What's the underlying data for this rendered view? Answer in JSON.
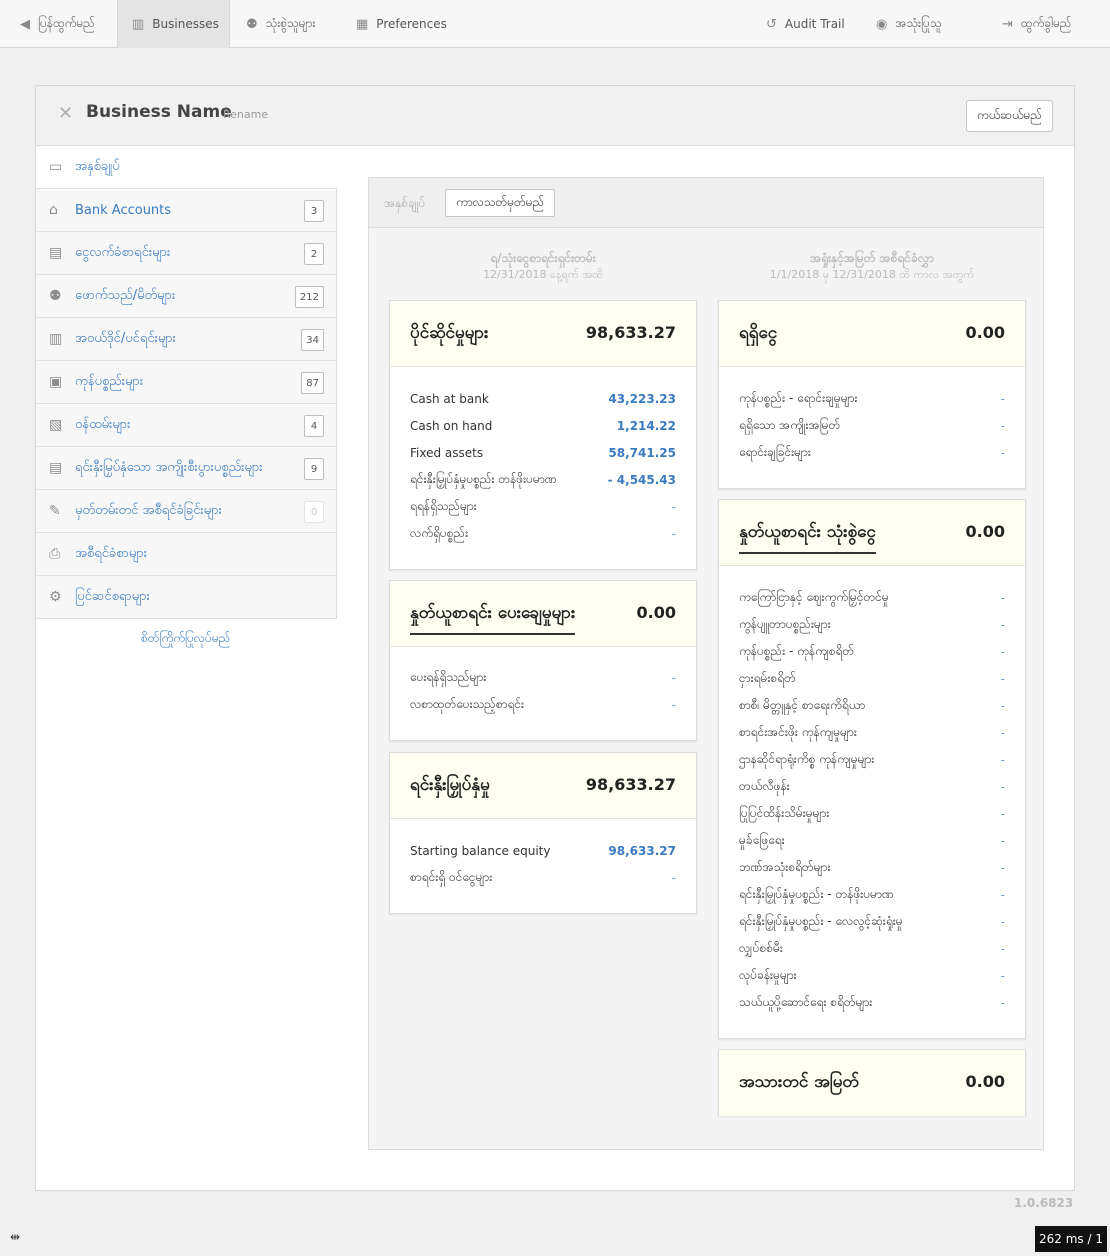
{
  "nav": {
    "back_label": "ပြန်ထွက်မည်",
    "businesses_label": "Businesses",
    "users_label": "သုံးစွဲသူများ",
    "preferences_label": "Preferences",
    "audit_label": "Audit Trail",
    "account_label": "အသုံးပြုသူ",
    "logout_label": "ထွက်ခွါမည်"
  },
  "header": {
    "business_name": "Business Name",
    "rename_label": "Rename",
    "close_label": "ကယ်ဆယ်မည်"
  },
  "sidebar": {
    "items": [
      {
        "label": "အနှစ်ချုပ်",
        "icon": "presentation-icon"
      },
      {
        "label": "Bank Accounts",
        "count": "3",
        "icon": "bank-icon"
      },
      {
        "label": "ငွေလက်ခံစာရင်းများ",
        "count": "2",
        "icon": "cash-register-icon"
      },
      {
        "label": "ဖောက်သည်/မိတ်များ",
        "count": "212",
        "icon": "people-icon"
      },
      {
        "label": "အဝယ်ဒိုင်/ပင်ရင်းများ",
        "count": "34",
        "icon": "building-icon"
      },
      {
        "label": "ကုန်ပစ္စည်းများ",
        "count": "87",
        "icon": "box-icon"
      },
      {
        "label": "ဝန်ထမ်းများ",
        "count": "4",
        "icon": "id-card-icon"
      },
      {
        "label": "ရင်းနှီးမြှပ်နှံသော အကျိုးစီးပွားပစ္စည်းများ",
        "count": "9",
        "icon": "ledger-icon"
      },
      {
        "label": "မှတ်တမ်းတင် အစီရင်ခံခြင်းများ",
        "count": "0",
        "icon": "quill-icon"
      },
      {
        "label": "အစီရင်ခံစာများ",
        "icon": "printer-icon"
      },
      {
        "label": "ပြင်ဆင်စရာများ",
        "icon": "gears-icon"
      }
    ],
    "customize_label": "စိတ်ကြိုက်ပြုလုပ်မည်"
  },
  "summary": {
    "title": "အနှစ်ချုပ်",
    "period_button": "ကာလသတ်မှတ်မည်",
    "left_col_title": "ရ/သုံးငွေစာရင်းရှင်းတမ်း",
    "left_col_sub": "12/31/2018 နေ့ရက် အထိ",
    "right_col_title": "အရှုံးနှင့်အမြတ် အစီရင်ခံလွှာ",
    "right_col_sub": "1/1/2018 မှ 12/31/2018 ထိ ကာလ အတွက်"
  },
  "cards": {
    "assets": {
      "title": "ပိုင်ဆိုင်မှုများ",
      "total": "98,633.27",
      "rows": [
        {
          "label": "Cash at bank",
          "value": "43,223.23"
        },
        {
          "label": "Cash on hand",
          "value": "1,214.22"
        },
        {
          "label": "Fixed assets",
          "value": "58,741.25"
        },
        {
          "label": "ရင်းနှီးမြှုပ်နှံမှုပစ္စည်း တန်ဖိုးပမာဏ",
          "value": "- 4,545.43"
        },
        {
          "label": "ရရန်ရှိသည်များ",
          "value": "-"
        },
        {
          "label": "လက်ရှိပစ္စည်း",
          "value": "-"
        }
      ]
    },
    "liabilities": {
      "title": "နှုတ်ယူစာရင်း ပေးချေမှုများ",
      "total": "0.00",
      "rows": [
        {
          "label": "ပေးရန်ရှိသည်များ",
          "value": "-"
        },
        {
          "label": "လစာထုတ်ပေးသည့်စာရင်း",
          "value": "-"
        }
      ]
    },
    "equity": {
      "title": "ရင်းနှီးမြှုပ်နှံမှု",
      "total": "98,633.27",
      "rows": [
        {
          "label": "Starting balance equity",
          "value": "98,633.27"
        },
        {
          "label": "စာရင်းရှိ ဝင်ငွေများ",
          "value": "-"
        }
      ]
    },
    "income": {
      "title": "ရရှိငွေ",
      "total": "0.00",
      "rows": [
        {
          "label": "ကုန်ပစ္စည်း - ရောင်းချမှုများ",
          "value": "-"
        },
        {
          "label": "ရရှိသော အကျိုးအမြတ်",
          "value": "-"
        },
        {
          "label": "ရောင်းချခြင်းများ",
          "value": "-"
        }
      ]
    },
    "expenses": {
      "title": "နှုတ်ယူစာရင်း သုံးစွဲငွေ",
      "total": "0.00",
      "rows": [
        {
          "label": "ကကြော်ငြာနှင့် ဈေးကွက်မြှင့်တင်မှု",
          "value": "-"
        },
        {
          "label": "ကွန်ပျူတာပစ္စည်းများ",
          "value": "-"
        },
        {
          "label": "ကုန်ပစ္စည်း - ကုန်ကျစရိတ်",
          "value": "-"
        },
        {
          "label": "ငှားရမ်းစရိတ်",
          "value": "-"
        },
        {
          "label": "စာစီ၊ မိတ္တူနှင့် စာရေးကိရိယာ",
          "value": "-"
        },
        {
          "label": "စာရင်းအင်းဖိုး ကုန်ကျမှုများ",
          "value": "-"
        },
        {
          "label": "ဌာနဆိုင်ရာရုံးကိစ္စ ကုန်ကျမှုများ",
          "value": "-"
        },
        {
          "label": "တယ်လီဖုန်း",
          "value": "-"
        },
        {
          "label": "ပြုပြင်ထိန်းသိမ်းမှုများ",
          "value": "-"
        },
        {
          "label": "မှုခ်ဖြေရေး",
          "value": "-"
        },
        {
          "label": "ဘဏ်အသုံးစရိတ်များ",
          "value": "-"
        },
        {
          "label": "ရင်းနှီးမြှုပ်နှံမှုပစ္စည်း - တန်ဖိုးပမာဏ",
          "value": "-"
        },
        {
          "label": "ရင်းနှီးမြှုပ်နှံမှုပစ္စည်း - လေလွင့်ဆုံးရှုံးမှု",
          "value": "-"
        },
        {
          "label": "လျှပ်စစ်မီး",
          "value": "-"
        },
        {
          "label": "လုပ်ခန်းမှုများ",
          "value": "-"
        },
        {
          "label": "သယ်ယူပို့ဆောင်ရေး စရိတ်များ",
          "value": "-"
        }
      ]
    },
    "net_profit": {
      "title": "အသားတင် အမြတ်",
      "total": "0.00"
    }
  },
  "footer": {
    "version": "1.0.6823",
    "timing": "262 ms / 1"
  },
  "colors": {
    "link": "#3a7bbf",
    "card_head": "#fefef2",
    "topbar": "#f7f7f7"
  }
}
